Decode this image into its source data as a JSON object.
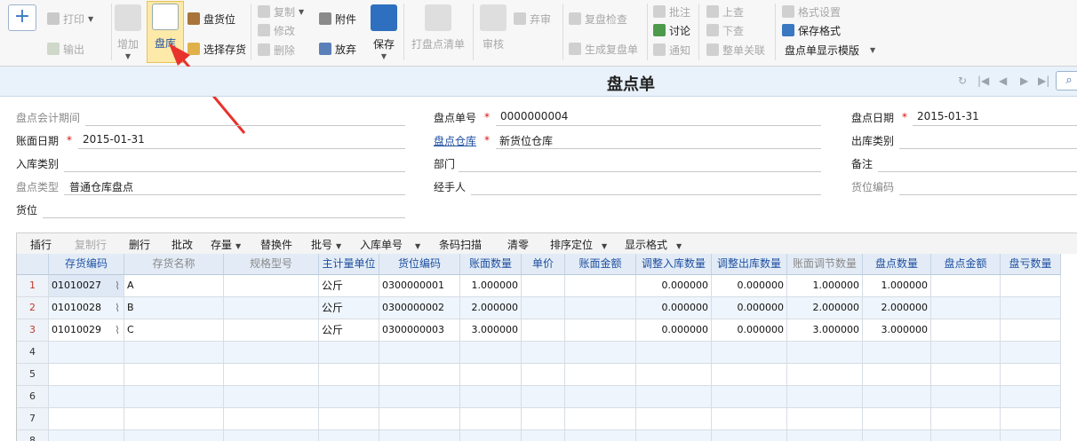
{
  "toolbar": {
    "add_glyph": "+",
    "print": "打印",
    "export": "输出",
    "add": "增加",
    "stocktake": "盘库",
    "stocktake_location": "盘货位",
    "select_stock": "选择存货",
    "copy": "复制",
    "modify": "修改",
    "delete": "删除",
    "attachment": "附件",
    "abandon": "放弃",
    "save": "保存",
    "print_list": "打盘点清单",
    "review": "审核",
    "reject": "弃审",
    "recheck": "复盘检查",
    "gen_recheck": "生成复盘单",
    "annotate": "批注",
    "discuss": "讨论",
    "notify": "通知",
    "query_up": "上查",
    "query_down": "下查",
    "doc_link": "整单关联",
    "format_settings": "格式设置",
    "save_format": "保存格式",
    "template": "盘点单显示模版",
    "icons": [
      "printer-icon",
      "export-icon",
      "add-icon",
      "stocktake-icon",
      "location-icon",
      "select-icon",
      "copy-icon",
      "edit-icon",
      "delete-icon",
      "paperclip-icon",
      "abandon-icon",
      "floppy-disk-icon",
      "list-icon",
      "stamp-icon",
      "discuss-icon",
      "bell-icon",
      "arrow-up-icon",
      "arrow-down-icon",
      "link-icon",
      "settings-icon",
      "save-format-icon"
    ]
  },
  "title": "盘点单",
  "header": {
    "accounting_period_label": "盘点会计期间",
    "accounting_period_value": "",
    "doc_no_label": "盘点单号",
    "doc_no_value": "0000000004",
    "doc_date_label": "盘点日期",
    "doc_date_value": "2015-01-31",
    "book_date_label": "账面日期",
    "book_date_value": "2015-01-31",
    "warehouse_label": "盘点仓库",
    "warehouse_value": "新货位仓库",
    "outbound_type_label": "出库类别",
    "outbound_type_value": "",
    "inbound_type_label": "入库类别",
    "inbound_type_value": "",
    "department_label": "部门",
    "department_value": "",
    "remark_label": "备注",
    "remark_value": "",
    "stocktake_type_label": "盘点类型",
    "stocktake_type_value": "普通仓库盘点",
    "handler_label": "经手人",
    "handler_value": "",
    "location_code_label": "货位编码",
    "location_code_value": "",
    "location_label": "货位",
    "location_value": "",
    "required_mark": "*"
  },
  "grid_toolbar": [
    "插行",
    "复制行",
    "删行",
    "批改",
    "存量",
    "替换件",
    "批号",
    "入库单号",
    "条码扫描",
    "清零",
    "排序定位",
    "显示格式"
  ],
  "grid": {
    "columns": [
      "",
      "存货编码",
      "存货名称",
      "规格型号",
      "主计量单位",
      "货位编码",
      "账面数量",
      "单价",
      "账面金额",
      "调整入库数量",
      "调整出库数量",
      "账面调节数量",
      "盘点数量",
      "盘点金额",
      "盘亏数量"
    ],
    "rows": [
      [
        "1",
        "01010027",
        "A",
        "",
        "公斤",
        "0300000001",
        "1.000000",
        "",
        "",
        "0.000000",
        "0.000000",
        "1.000000",
        "1.000000",
        "",
        ""
      ],
      [
        "2",
        "01010028",
        "B",
        "",
        "公斤",
        "0300000002",
        "2.000000",
        "",
        "",
        "0.000000",
        "0.000000",
        "2.000000",
        "2.000000",
        "",
        ""
      ],
      [
        "3",
        "01010029",
        "C",
        "",
        "公斤",
        "0300000003",
        "3.000000",
        "",
        "",
        "0.000000",
        "0.000000",
        "3.000000",
        "3.000000",
        "",
        ""
      ],
      [
        "4",
        "",
        "",
        "",
        "",
        "",
        "",
        "",
        "",
        "",
        "",
        "",
        "",
        "",
        ""
      ],
      [
        "5",
        "",
        "",
        "",
        "",
        "",
        "",
        "",
        "",
        "",
        "",
        "",
        "",
        "",
        ""
      ],
      [
        "6",
        "",
        "",
        "",
        "",
        "",
        "",
        "",
        "",
        "",
        "",
        "",
        "",
        "",
        ""
      ],
      [
        "7",
        "",
        "",
        "",
        "",
        "",
        "",
        "",
        "",
        "",
        "",
        "",
        "",
        "",
        ""
      ],
      [
        "8",
        "",
        "",
        "",
        "",
        "",
        "",
        "",
        "",
        "",
        "",
        "",
        "",
        "",
        ""
      ]
    ]
  },
  "colors": {
    "accent": "#3a78c2",
    "required": "#dd1111",
    "header_bg": "#e3ecf6",
    "active_button": "#fde9a8",
    "annotation_arrow": "#e8322c"
  }
}
